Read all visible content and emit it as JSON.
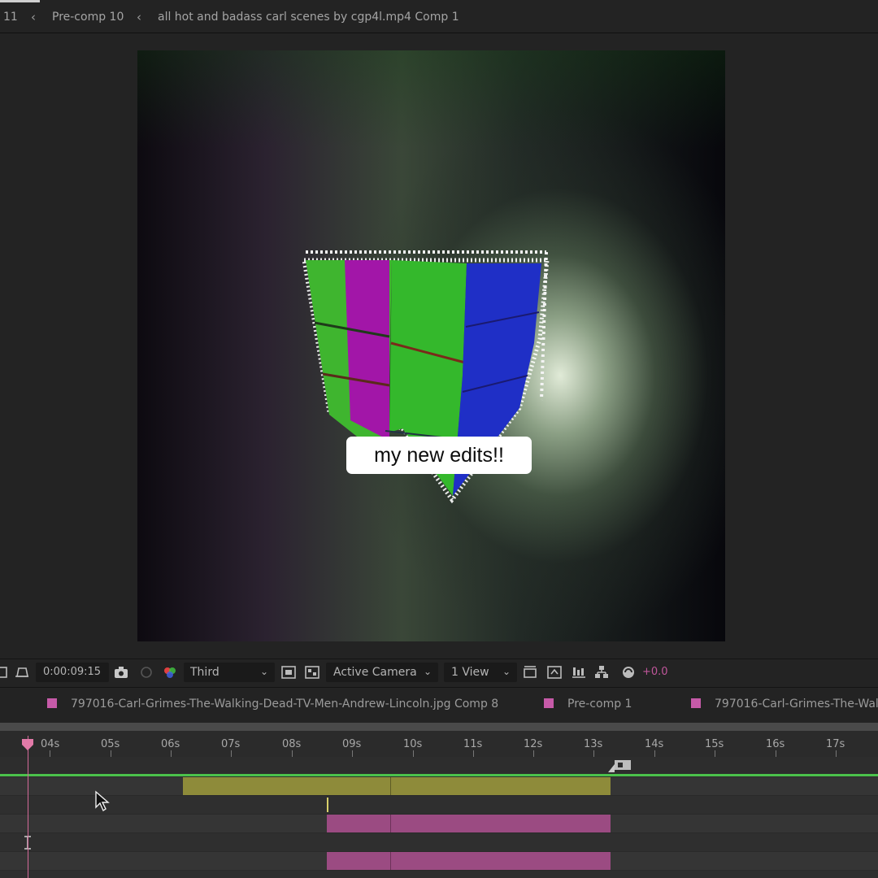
{
  "breadcrumbs": {
    "items": [
      "11",
      "Pre-comp 10",
      "all hot and badass carl scenes by cgp4l.mp4 Comp 1"
    ]
  },
  "viewer": {
    "caption": "my new edits!!"
  },
  "toolbar": {
    "timecode": "0:00:09:15",
    "view_mode": "Third",
    "camera": "Active Camera",
    "views": "1 View",
    "exposure": "+0.0"
  },
  "timeline": {
    "tabs": [
      {
        "label": "797016-Carl-Grimes-The-Walking-Dead-TV-Men-Andrew-Lincoln.jpg Comp 8"
      },
      {
        "label": "Pre-comp 1"
      },
      {
        "label": "797016-Carl-Grimes-The-Wal"
      }
    ],
    "ruler_labels": [
      "04s",
      "05s",
      "06s",
      "07s",
      "08s",
      "09s",
      "10s",
      "11s",
      "12s",
      "13s",
      "14s",
      "15s",
      "16s",
      "17s"
    ]
  },
  "colors": {
    "label_pink": "#c65aa8",
    "olive_bar": "#8e8b3a",
    "pink_bar": "#9b4b82",
    "green_line": "#4bc24b",
    "playhead": "#d46a9a"
  }
}
